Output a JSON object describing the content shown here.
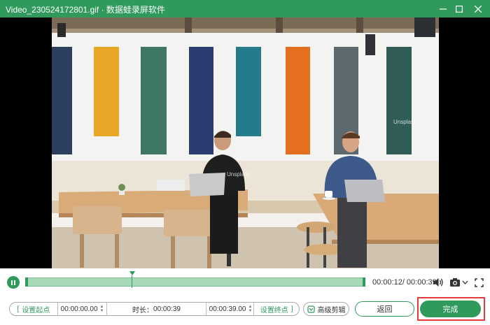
{
  "window": {
    "title": "Video_230524172801.gif · 数据蛙录屏软件",
    "controls": [
      "minimize-icon",
      "maximize-icon",
      "close-icon"
    ]
  },
  "video": {
    "watermark": "Unsplash"
  },
  "playback": {
    "time": "00:00:12/ 00:00:39"
  },
  "trim": {
    "set_start_label": "设置起点",
    "start_value": "00:00:00.00",
    "duration_label": "时长：",
    "duration_value": "00:00:39",
    "end_value": "00:00:39.00",
    "set_end_label": "设置终点"
  },
  "buttons": {
    "advanced": "高级剪辑",
    "back": "返回",
    "finish": "完成"
  },
  "colors": {
    "accent": "#2f9a5c",
    "highlight": "#e23b3b"
  }
}
